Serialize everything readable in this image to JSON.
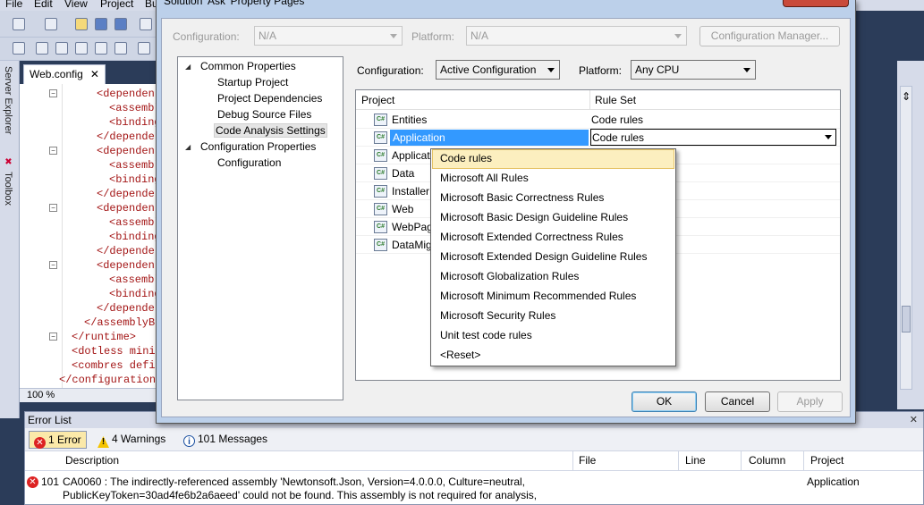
{
  "menubar": {
    "items": [
      "File",
      "Edit",
      "View",
      "Project",
      "Bu"
    ]
  },
  "side_tabs": [
    "Server Explorer",
    "Toolbox"
  ],
  "editor": {
    "tab_label": "Web.config",
    "tab_close": "✕",
    "lines": [
      "<dependen",
      "<assembl",
      "<binding",
      "</depender",
      "<dependen",
      "<assembl",
      "<binding",
      "</depender",
      "<dependen",
      "<assembl",
      "<binding",
      "</depender",
      "<dependen",
      "<assembl",
      "<binding",
      "</depender",
      "</assemblyBi",
      "</runtime>",
      "<dotless minif",
      "<combres defin",
      "</configuration>"
    ],
    "zoom": "100 %"
  },
  "dialog": {
    "title": "Solution 'Ask' Property Pages",
    "top": {
      "configuration_label": "Configuration:",
      "configuration_value": "N/A",
      "platform_label": "Platform:",
      "platform_value": "N/A",
      "config_manager_button": "Configuration Manager..."
    },
    "tree": [
      {
        "label": "Common Properties",
        "level": 0,
        "expanded": true
      },
      {
        "label": "Startup Project",
        "level": 1
      },
      {
        "label": "Project Dependencies",
        "level": 1
      },
      {
        "label": "Debug Source Files",
        "level": 1
      },
      {
        "label": "Code Analysis Settings",
        "level": 1,
        "selected": true
      },
      {
        "label": "Configuration Properties",
        "level": 0,
        "expanded": true
      },
      {
        "label": "Configuration",
        "level": 1
      }
    ],
    "panel": {
      "configuration_label": "Configuration:",
      "configuration_value": "Active Configuration",
      "platform_label": "Platform:",
      "platform_value": "Any CPU",
      "grid_headers": [
        "Project",
        "Rule Set"
      ],
      "projects": [
        {
          "name": "Entities",
          "rule_set": "Code rules"
        },
        {
          "name": "Application",
          "rule_set": "Code rules",
          "selected": true
        },
        {
          "name": "Application.UnitTests",
          "rule_set": ""
        },
        {
          "name": "Data",
          "rule_set": ""
        },
        {
          "name": "Installer",
          "rule_set": ""
        },
        {
          "name": "Web",
          "rule_set": ""
        },
        {
          "name": "WebPages",
          "rule_set": ""
        },
        {
          "name": "DataMigrations",
          "rule_set": ""
        }
      ],
      "project_icon": "C#",
      "ruleset_options": [
        "Code rules",
        "Microsoft All Rules",
        "Microsoft Basic Correctness Rules",
        "Microsoft Basic Design Guideline Rules",
        "Microsoft Extended Correctness Rules",
        "Microsoft Extended Design Guideline Rules",
        "Microsoft Globalization Rules",
        "Microsoft Minimum Recommended Rules",
        "Microsoft Security Rules",
        "Unit test code rules",
        "<Reset>"
      ],
      "highlighted_option": "Code rules"
    },
    "buttons": {
      "ok": "OK",
      "cancel": "Cancel",
      "apply": "Apply"
    }
  },
  "error_list": {
    "title": "Error List",
    "filters": {
      "errors": "1 Error",
      "warnings": "4 Warnings",
      "messages": "101 Messages"
    },
    "columns": [
      "Description",
      "File",
      "Line",
      "Column",
      "Project"
    ],
    "rows": [
      {
        "number": "101",
        "description_line1": "CA0060 : The indirectly-referenced assembly 'Newtonsoft.Json, Version=4.0.0.0, Culture=neutral,",
        "description_line2": "PublicKeyToken=30ad4fe6b2a6aeed' could not be found. This assembly is not required for analysis,",
        "project": "Application"
      }
    ]
  }
}
